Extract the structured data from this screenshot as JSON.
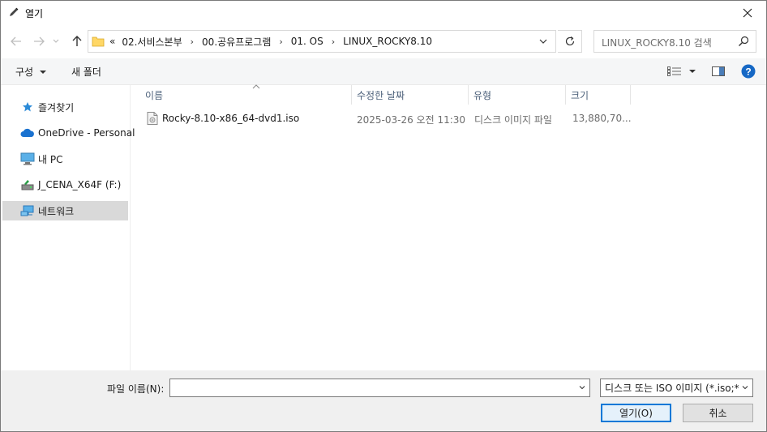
{
  "window": {
    "title": "열기",
    "close_icon": "close-icon"
  },
  "nav": {
    "back_icon": "back-arrow-icon",
    "forward_icon": "forward-arrow-icon",
    "history_icon": "chevron-down-icon",
    "up_icon": "up-arrow-icon",
    "overflow": "«",
    "breadcrumbs": [
      "02.서비스본부",
      "00.공유프로그램",
      "01. OS",
      "LINUX_ROCKY8.10"
    ],
    "search_placeholder": "LINUX_ROCKY8.10 검색"
  },
  "toolbar": {
    "organize": "구성",
    "new_folder": "새 폴더"
  },
  "sidebar": {
    "items": [
      {
        "label": "즐겨찾기",
        "icon": "star-icon"
      },
      {
        "label": "OneDrive - Personal",
        "icon": "cloud-icon"
      },
      {
        "label": "내 PC",
        "icon": "computer-icon"
      },
      {
        "label": "J_CENA_X64F (F:)",
        "icon": "drive-icon"
      },
      {
        "label": "네트워크",
        "icon": "network-icon",
        "selected": true
      }
    ]
  },
  "columns": {
    "name": "이름",
    "modified": "수정한 날짜",
    "type": "유형",
    "size": "크기"
  },
  "files": [
    {
      "name": "Rocky-8.10-x86_64-dvd1.iso",
      "modified": "2025-03-26 오전 11:30",
      "type": "디스크 이미지 파일",
      "size": "13,880,70...",
      "icon": "disc-image-file-icon"
    }
  ],
  "bottom": {
    "filename_label": "파일 이름(N):",
    "filename_value": "",
    "filetype": "디스크 또는 ISO 이미지 (*.iso;*",
    "open_button": "열기(O)",
    "cancel_button": "취소"
  },
  "colors": {
    "accent": "#0078d7",
    "header_text": "#4c607a",
    "sidebar_selected": "#d9d9d9"
  }
}
